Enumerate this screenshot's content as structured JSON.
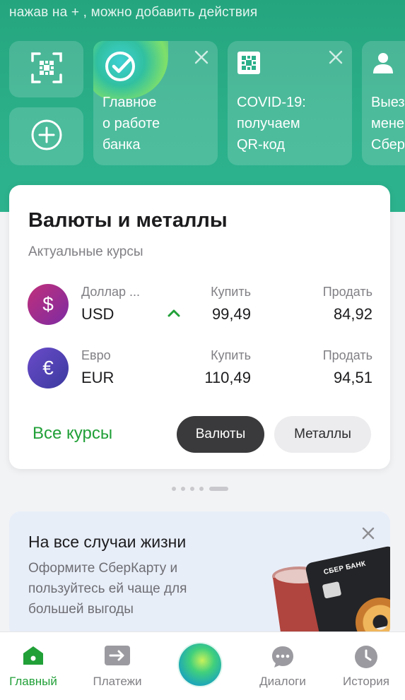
{
  "header": {
    "hint": "нажав на + , можно добавить действия"
  },
  "quick_actions": {
    "qr_icon": "qr-scan-icon",
    "add_icon": "plus-circle-icon"
  },
  "stories": [
    {
      "lines": [
        "Главное",
        "о работе",
        "банка"
      ],
      "icon": "sber-logo-icon"
    },
    {
      "lines": [
        "COVID-19:",
        "получаем",
        "QR-код"
      ],
      "icon": "qr-code-icon"
    },
    {
      "lines": [
        "Выез",
        "мене",
        "Сбер"
      ],
      "icon": "person-icon"
    }
  ],
  "rates_card": {
    "title": "Валюты и металлы",
    "subtitle": "Актуальные курсы",
    "buy_label": "Купить",
    "sell_label": "Продать",
    "rows": [
      {
        "name": "Доллар ...",
        "code": "USD",
        "symbol": "$",
        "buy": "99,49",
        "sell": "84,92",
        "trend": "up"
      },
      {
        "name": "Евро",
        "code": "EUR",
        "symbol": "€",
        "buy": "110,49",
        "sell": "94,51"
      }
    ],
    "all_rates": "Все курсы",
    "segments": {
      "currencies": "Валюты",
      "metals": "Металлы"
    }
  },
  "promo": {
    "title": "На все случаи жизни",
    "text": "Оформите СберКарту и пользуйтесь ей чаще для большей выгоды",
    "card_brand": "СБЕР БАНК"
  },
  "bottom_nav": {
    "main": "Главный",
    "payments": "Платежи",
    "dialogs": "Диалоги",
    "history": "История"
  },
  "colors": {
    "brand_green": "#21a038",
    "header_green": "#2bb08a"
  }
}
